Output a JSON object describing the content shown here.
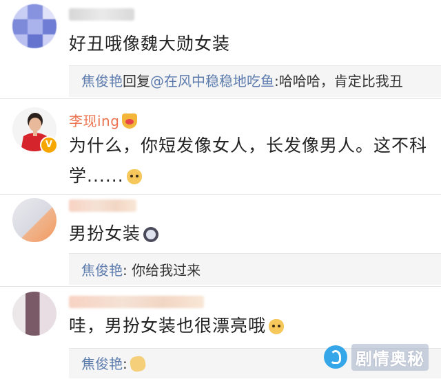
{
  "comments": [
    {
      "text": "好丑哦像魏大勋女装",
      "reply": {
        "name": "焦俊艳",
        "mid": "回复",
        "mention": "@在风中稳稳地吃鱼",
        "body": ":哈哈哈，肯定比我丑"
      }
    },
    {
      "nickname": "李现ing",
      "badge": "V",
      "text_line1": "为什么，你短发像女人，长发像男人。这不科",
      "text_line2": "学......"
    },
    {
      "text": "男扮女装",
      "reply": {
        "name": "焦俊艳",
        "body": ": 你给我过来"
      }
    },
    {
      "text": "哇，男扮女装也很漂亮哦",
      "reply": {
        "name": "焦俊艳",
        "body": ":"
      }
    }
  ],
  "watermark": {
    "text": "剧情奥秘"
  },
  "icons": {
    "emoji_dog": "dog-face-emoji",
    "emoji_crying": "crying-face-emoji",
    "emoji_crown": "crown-emoji",
    "emoji_hands": "clapping-hands-emoji",
    "logo": "circle-logo"
  },
  "colors": {
    "nickname": "#eb7350",
    "reply_name": "#5d7cae",
    "reply_bg": "#f5f5f5",
    "verified_badge": "#f7a600"
  }
}
